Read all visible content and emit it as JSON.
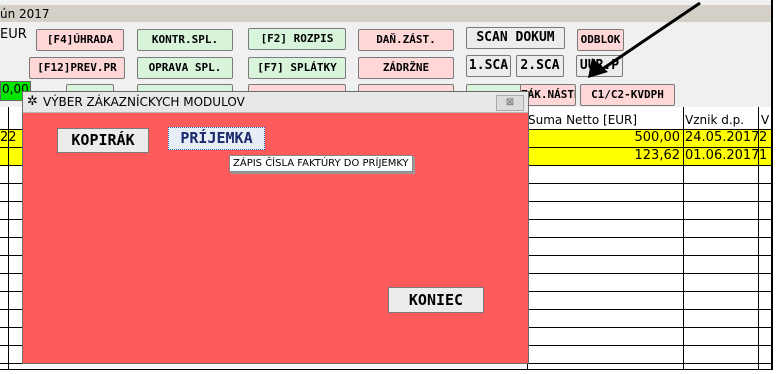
{
  "period": "ún 2017",
  "currency": "EUR",
  "green_value": "0,00",
  "toolbar": {
    "row1": [
      "[F4]ÚHRADA",
      "KONTR.SPL.",
      "[F2] ROZPIS",
      "DAŇ.ZÁST.",
      "SCAN DOKUM",
      "ODBLOK"
    ],
    "row2": [
      "[F12]PREV.PR",
      "OPRAVA SPL.",
      "[F7] SPLÁTKY",
      "ZÁDRŽNE",
      "1.SCA",
      "2.SCA",
      "UUR.P"
    ],
    "row3": [
      "ZÁK.NÁSTR",
      "C1/C2-KVDPH"
    ]
  },
  "grid": {
    "headers": [
      "Suma Netto [EUR]",
      "Vznik d.p.",
      "V"
    ],
    "rows": [
      {
        "left_cut": "22",
        "suma": "500,00",
        "vznik": "24.05.2017",
        "right_cut": "2"
      },
      {
        "left_cut": "",
        "suma": "123,62",
        "vznik": "01.06.2017",
        "right_cut": "1"
      }
    ]
  },
  "dialog": {
    "title": "VÝBER ZÁKAZNÍCKYCH MODULOV",
    "kopirak": "KOPIRÁK",
    "prijemka": "PRÍJEMKA",
    "tooltip": "ZÁPIS ČÍSLA FAKTÚRY DO PRÍJEMKY",
    "koniec": "KONIEC",
    "close_glyph": "⊠"
  },
  "colors": {
    "dialog_bg": "#fd5b5b",
    "highlight_row": "#ffff00",
    "green_field": "#00e400"
  }
}
